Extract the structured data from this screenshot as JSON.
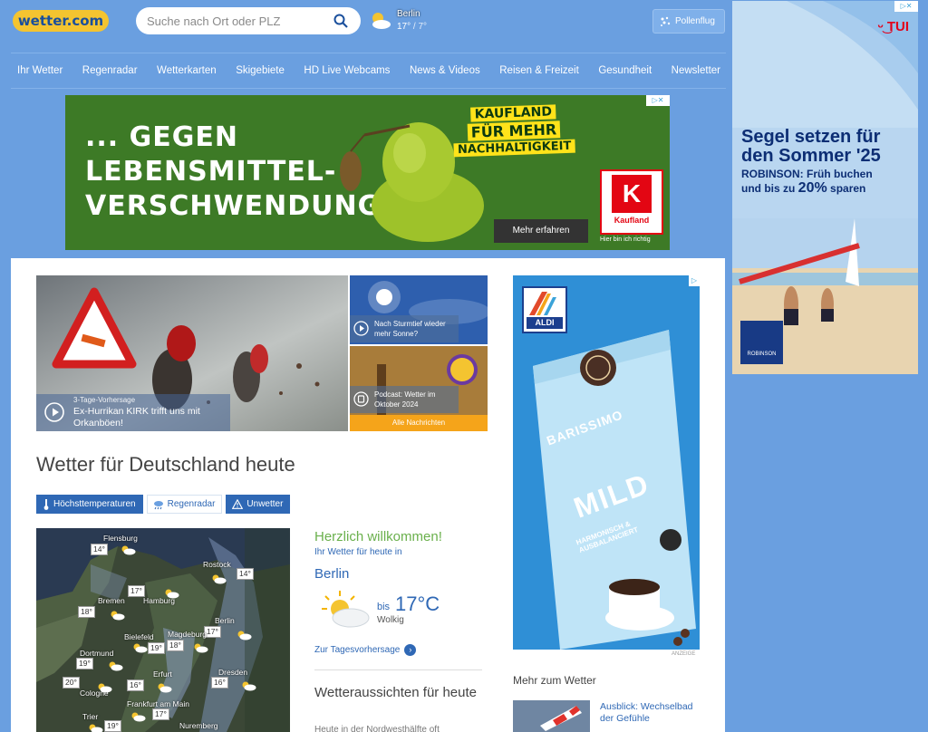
{
  "header": {
    "logo": "wetter.com",
    "search_placeholder": "Suche nach Ort oder PLZ",
    "weather_city": "Berlin",
    "weather_high": "17°",
    "weather_low": "/ 7°",
    "pollen_label": "Pollenflug"
  },
  "nav": {
    "items": [
      "Ihr Wetter",
      "Regenradar",
      "Wetterkarten",
      "Skigebiete",
      "HD Live Webcams",
      "News & Videos",
      "Reisen & Freizeit",
      "Gesundheit",
      "Newsletter"
    ]
  },
  "kaufland_ad": {
    "headline_1": "... GEGEN",
    "headline_2": "LEBENSMITTEL-",
    "headline_3": "VERSCHWENDUNG",
    "badge_1": "KAUFLAND",
    "badge_2": "FÜR MEHR",
    "badge_3": "NACHHALTIGKEIT",
    "logo_text": "Kaufland",
    "cta": "Mehr erfahren",
    "tagline": "Hier bin ich richtig"
  },
  "tui_ad": {
    "logo": "TUI",
    "headline_1": "Segel setzen für",
    "headline_2": "den Sommer '25",
    "sub_1": "ROBINSON: Früh buchen",
    "sub_2a": "und bis zu ",
    "sub_2b": "20%",
    "sub_2c": " sparen",
    "robinson": "ROBINSON"
  },
  "hero": {
    "kicker": "3-Tage-Vorhersage",
    "title": "Ex-Hurrikan KIRK trifft uns mit Orkanböen!"
  },
  "side_news": [
    {
      "title": "Nach Sturmtief wieder mehr Sonne?"
    },
    {
      "title": "Podcast: Wetter im Oktober 2024"
    }
  ],
  "all_news": "Alle Nachrichten",
  "page_title": "Wetter für Deutschland heute",
  "tabs": [
    {
      "label": "Höchsttemperaturen"
    },
    {
      "label": "Regenradar"
    },
    {
      "label": "Unwetter"
    }
  ],
  "map": {
    "cities": [
      {
        "name": "Flensburg",
        "temp": "14°"
      },
      {
        "name": "Rostock",
        "temp": "14°"
      },
      {
        "name": "Bremen",
        "temp": "18°"
      },
      {
        "name": "Hamburg",
        "temp": "17°"
      },
      {
        "name": "Berlin",
        "temp": "17°"
      },
      {
        "name": "Bielefeld",
        "temp": "19°"
      },
      {
        "name": "Magdeburg",
        "temp": "18°"
      },
      {
        "name": "Dortmund",
        "temp": "19°"
      },
      {
        "name": "Cologne",
        "temp": "20°"
      },
      {
        "name": "Erfurt",
        "temp": "16°"
      },
      {
        "name": "Dresden",
        "temp": "16°"
      },
      {
        "name": "Frankfurt am Main",
        "temp": "17°"
      },
      {
        "name": "Trier",
        "temp": "19°"
      },
      {
        "name": "Nuremberg",
        "temp": ""
      }
    ]
  },
  "welcome": {
    "title": "Herzlich willkommen!",
    "subtitle": "Ihr Wetter für heute in",
    "city": "Berlin",
    "bis": "bis",
    "temp": "17°C",
    "desc": "Wolkig",
    "link": "Zur Tagesvorhersage"
  },
  "outlook": {
    "title": "Wetteraussichten für heute",
    "text": "Heute in der Nordwesthälfte oft"
  },
  "aldi_ad": {
    "logo": "ALDI",
    "brand": "BARISSIMO",
    "product": "MILD",
    "product_sub": "HARMONISCH & AUSBALANCIERT",
    "anzeige": "ANZEIGE"
  },
  "more": {
    "title": "Mehr zum Wetter",
    "link": "Ausblick: Wechselbad der Gefühle"
  },
  "colors": {
    "page_bg": "#6a9fe0",
    "brand_blue": "#2f68b5",
    "logo_yellow": "#f4c430",
    "welcome_green": "#6ab04c",
    "news_orange": "#f5a41a"
  }
}
